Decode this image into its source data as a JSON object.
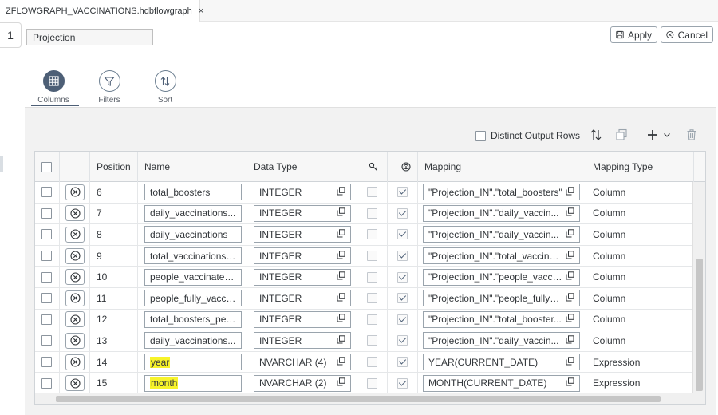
{
  "editor_tab": {
    "title": "ZFLOWGRAPH_VACCINATIONS.hdbflowgraph",
    "close_glyph": "×"
  },
  "node": {
    "number": "1",
    "name": "Projection"
  },
  "actions": {
    "apply": "Apply",
    "cancel": "Cancel"
  },
  "view_tabs": [
    {
      "label": "Columns",
      "icon": "grid-icon",
      "active": true
    },
    {
      "label": "Filters",
      "icon": "filter-icon",
      "active": false
    },
    {
      "label": "Sort",
      "icon": "sort-icon",
      "active": false
    }
  ],
  "toolbar": {
    "distinct_label": "Distinct Output Rows",
    "distinct_checked": false,
    "icons": [
      "sort-arrows-icon",
      "copy-icon",
      "add-icon",
      "chevron-down-icon",
      "trash-icon"
    ]
  },
  "table": {
    "columns": [
      "Position",
      "Name",
      "Data Type",
      "key-icon",
      "nullable-icon",
      "Mapping",
      "Mapping Type"
    ],
    "headers": {
      "position": "Position",
      "name": "Name",
      "data_type": "Data Type",
      "mapping": "Mapping",
      "mapping_type": "Mapping Type"
    },
    "rows": [
      {
        "position": "6",
        "name": "total_boosters",
        "name_highlight": false,
        "data_type": "INTEGER",
        "mapping": "\"Projection_IN\".\"total_boosters\"",
        "mapping_type": "Column"
      },
      {
        "position": "7",
        "name": "daily_vaccinations...",
        "name_highlight": false,
        "data_type": "INTEGER",
        "mapping": "\"Projection_IN\".\"daily_vaccin...",
        "mapping_type": "Column"
      },
      {
        "position": "8",
        "name": "daily_vaccinations",
        "name_highlight": false,
        "data_type": "INTEGER",
        "mapping": "\"Projection_IN\".\"daily_vaccin...",
        "mapping_type": "Column"
      },
      {
        "position": "9",
        "name": "total_vaccinations_...",
        "name_highlight": false,
        "data_type": "INTEGER",
        "mapping": "\"Projection_IN\".\"total_vaccina...",
        "mapping_type": "Column"
      },
      {
        "position": "10",
        "name": "people_vaccinated...",
        "name_highlight": false,
        "data_type": "INTEGER",
        "mapping": "\"Projection_IN\".\"people_vacci...",
        "mapping_type": "Column"
      },
      {
        "position": "11",
        "name": "people_fully_vacci...",
        "name_highlight": false,
        "data_type": "INTEGER",
        "mapping": "\"Projection_IN\".\"people_fully_...",
        "mapping_type": "Column"
      },
      {
        "position": "12",
        "name": "total_boosters_per...",
        "name_highlight": false,
        "data_type": "INTEGER",
        "mapping": "\"Projection_IN\".\"total_booster...",
        "mapping_type": "Column"
      },
      {
        "position": "13",
        "name": "daily_vaccinations...",
        "name_highlight": false,
        "data_type": "INTEGER",
        "mapping": "\"Projection_IN\".\"daily_vaccin...",
        "mapping_type": "Column"
      },
      {
        "position": "14",
        "name": "year",
        "name_highlight": true,
        "data_type": "NVARCHAR (4)",
        "mapping": "YEAR(CURRENT_DATE)",
        "mapping_type": "Expression"
      },
      {
        "position": "15",
        "name": "month",
        "name_highlight": true,
        "data_type": "NVARCHAR (2)",
        "mapping": "MONTH(CURRENT_DATE)",
        "mapping_type": "Expression"
      }
    ]
  },
  "colors": {
    "accent": "#4d5f76",
    "highlight": "#f7f32a",
    "panel_bg": "#f2f2f2"
  }
}
